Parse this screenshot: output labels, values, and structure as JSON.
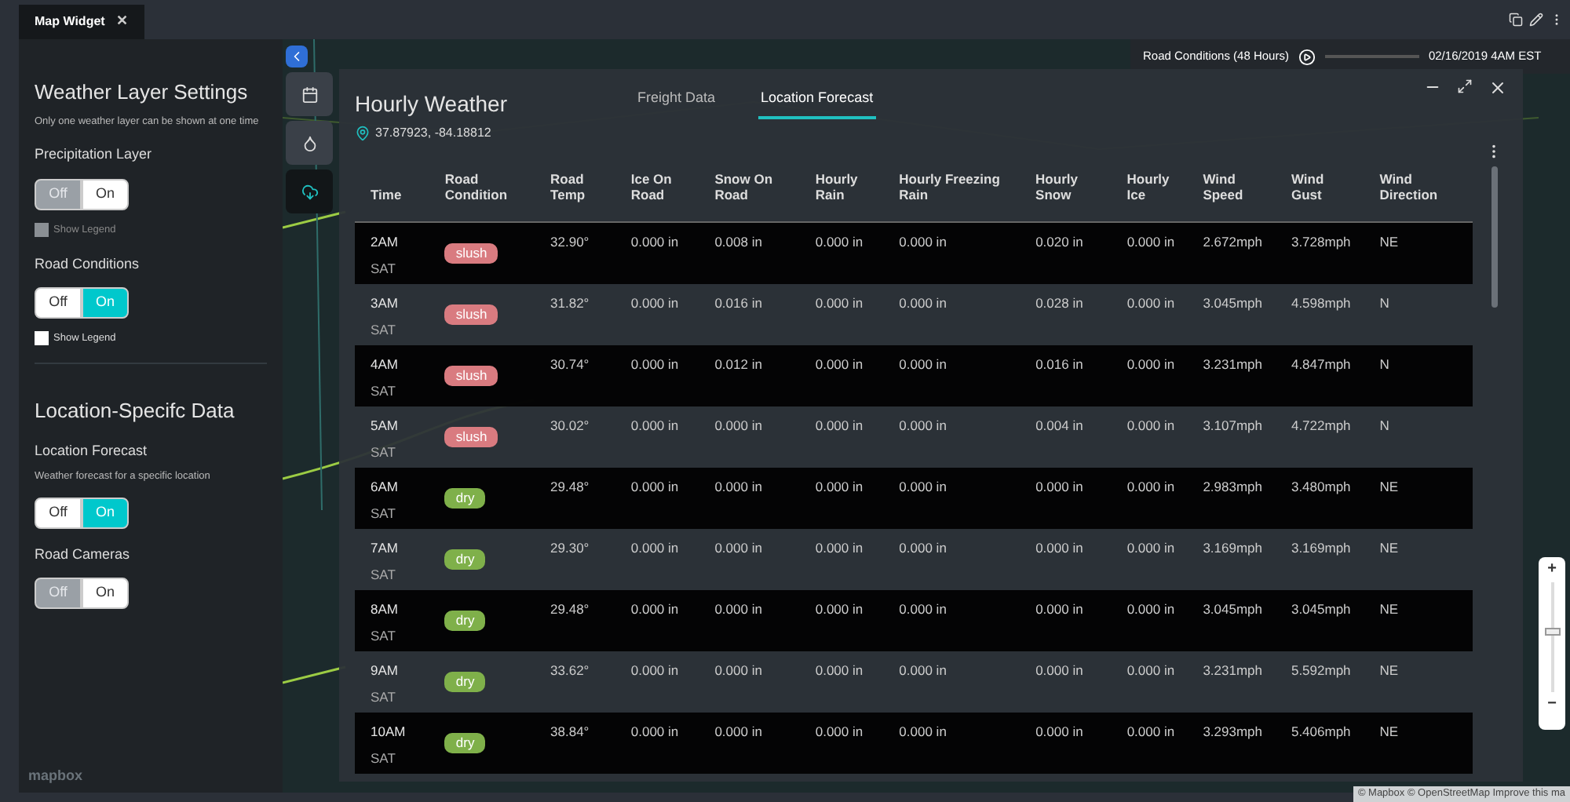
{
  "window_tab": {
    "title": "Map Widget",
    "close": "✕"
  },
  "settings": {
    "sections": [
      {
        "title": "Weather Layer Settings",
        "note": "Only one weather layer can be shown at one time",
        "items": [
          {
            "label": "Precipitation Layer",
            "options": [
              {
                "label": "Off",
                "selected": true
              },
              {
                "label": "On",
                "selected": false
              }
            ],
            "legend": {
              "label": "Show Legend",
              "checked": false,
              "disabled": true
            }
          },
          {
            "label": "Road Conditions",
            "options": [
              {
                "label": "Off",
                "selected": false
              },
              {
                "label": "On",
                "selected": true
              }
            ],
            "legend": {
              "label": "Show Legend",
              "checked": false,
              "disabled": false
            }
          }
        ]
      },
      {
        "title": "Location-Specifc Data",
        "items": [
          {
            "label": "Location Forecast",
            "note": "Weather forecast for a specific location",
            "options": [
              {
                "label": "Off",
                "selected": false
              },
              {
                "label": "On",
                "selected": true
              }
            ]
          },
          {
            "label": "Road Cameras",
            "options": [
              {
                "label": "Off",
                "selected": true
              },
              {
                "label": "On",
                "selected": false
              }
            ]
          }
        ]
      }
    ],
    "logo": "mapbox"
  },
  "side_toolbar": [
    {
      "kind": "calendar",
      "selected": false
    },
    {
      "kind": "drop",
      "selected": false
    },
    {
      "kind": "cloud",
      "selected": true
    }
  ],
  "timeline": {
    "label": "Road Conditions (48 Hours)",
    "level": 0.0,
    "time": "02/16/2019 4AM EST"
  },
  "forecast": {
    "title": "Hourly Weather",
    "coords": "37.87923, -84.18812",
    "tabs": [
      {
        "label": "Freight Data",
        "selected": false
      },
      {
        "label": "Location Forecast",
        "selected": true
      }
    ],
    "columns": [
      "Time",
      "Road Condition",
      "Road Temp",
      "Ice On Road",
      "Snow On Road",
      "Hourly Rain",
      "Hourly Freezing Rain",
      "Hourly Snow",
      "Hourly Ice",
      "Wind Speed",
      "Wind Gust",
      "Wind Direction"
    ],
    "rows": [
      {
        "time": "2AM",
        "day": "SAT",
        "condition": {
          "label": "slush",
          "color": "#d97b80"
        },
        "road_temp": "32.90°",
        "ice_on_road": "0.000 in",
        "snow_on_road": "0.008 in",
        "hourly_rain": "0.000 in",
        "hourly_freezing_rain": "0.000 in",
        "hourly_snow": "0.020 in",
        "hourly_ice": "0.000 in",
        "wind_speed": "2.672mph",
        "wind_gust": "3.728mph",
        "wind_direction": "NE"
      },
      {
        "time": "3AM",
        "day": "SAT",
        "condition": {
          "label": "slush",
          "color": "#d97b80"
        },
        "road_temp": "31.82°",
        "ice_on_road": "0.000 in",
        "snow_on_road": "0.016 in",
        "hourly_rain": "0.000 in",
        "hourly_freezing_rain": "0.000 in",
        "hourly_snow": "0.028 in",
        "hourly_ice": "0.000 in",
        "wind_speed": "3.045mph",
        "wind_gust": "4.598mph",
        "wind_direction": "N"
      },
      {
        "time": "4AM",
        "day": "SAT",
        "condition": {
          "label": "slush",
          "color": "#d97b80"
        },
        "road_temp": "30.74°",
        "ice_on_road": "0.000 in",
        "snow_on_road": "0.012 in",
        "hourly_rain": "0.000 in",
        "hourly_freezing_rain": "0.000 in",
        "hourly_snow": "0.016 in",
        "hourly_ice": "0.000 in",
        "wind_speed": "3.231mph",
        "wind_gust": "4.847mph",
        "wind_direction": "N"
      },
      {
        "time": "5AM",
        "day": "SAT",
        "condition": {
          "label": "slush",
          "color": "#d97b80"
        },
        "road_temp": "30.02°",
        "ice_on_road": "0.000 in",
        "snow_on_road": "0.000 in",
        "hourly_rain": "0.000 in",
        "hourly_freezing_rain": "0.000 in",
        "hourly_snow": "0.004 in",
        "hourly_ice": "0.000 in",
        "wind_speed": "3.107mph",
        "wind_gust": "4.722mph",
        "wind_direction": "N"
      },
      {
        "time": "6AM",
        "day": "SAT",
        "condition": {
          "label": "dry",
          "color": "#7fb04a"
        },
        "road_temp": "29.48°",
        "ice_on_road": "0.000 in",
        "snow_on_road": "0.000 in",
        "hourly_rain": "0.000 in",
        "hourly_freezing_rain": "0.000 in",
        "hourly_snow": "0.000 in",
        "hourly_ice": "0.000 in",
        "wind_speed": "2.983mph",
        "wind_gust": "3.480mph",
        "wind_direction": "NE"
      },
      {
        "time": "7AM",
        "day": "SAT",
        "condition": {
          "label": "dry",
          "color": "#7fb04a"
        },
        "road_temp": "29.30°",
        "ice_on_road": "0.000 in",
        "snow_on_road": "0.000 in",
        "hourly_rain": "0.000 in",
        "hourly_freezing_rain": "0.000 in",
        "hourly_snow": "0.000 in",
        "hourly_ice": "0.000 in",
        "wind_speed": "3.169mph",
        "wind_gust": "3.169mph",
        "wind_direction": "NE"
      },
      {
        "time": "8AM",
        "day": "SAT",
        "condition": {
          "label": "dry",
          "color": "#7fb04a"
        },
        "road_temp": "29.48°",
        "ice_on_road": "0.000 in",
        "snow_on_road": "0.000 in",
        "hourly_rain": "0.000 in",
        "hourly_freezing_rain": "0.000 in",
        "hourly_snow": "0.000 in",
        "hourly_ice": "0.000 in",
        "wind_speed": "3.045mph",
        "wind_gust": "3.045mph",
        "wind_direction": "NE"
      },
      {
        "time": "9AM",
        "day": "SAT",
        "condition": {
          "label": "dry",
          "color": "#7fb04a"
        },
        "road_temp": "33.62°",
        "ice_on_road": "0.000 in",
        "snow_on_road": "0.000 in",
        "hourly_rain": "0.000 in",
        "hourly_freezing_rain": "0.000 in",
        "hourly_snow": "0.000 in",
        "hourly_ice": "0.000 in",
        "wind_speed": "3.231mph",
        "wind_gust": "5.592mph",
        "wind_direction": "NE"
      },
      {
        "time": "10AM",
        "day": "SAT",
        "condition": {
          "label": "dry",
          "color": "#7fb04a"
        },
        "road_temp": "38.84°",
        "ice_on_road": "0.000 in",
        "snow_on_road": "0.000 in",
        "hourly_rain": "0.000 in",
        "hourly_freezing_rain": "0.000 in",
        "hourly_snow": "0.000 in",
        "hourly_ice": "0.000 in",
        "wind_speed": "3.293mph",
        "wind_gust": "5.406mph",
        "wind_direction": "NE"
      }
    ]
  },
  "zoom": {
    "plus": "+",
    "minus": "−",
    "level": 0.55
  },
  "attribution": "© Mapbox © OpenStreetMap Improve this ma"
}
